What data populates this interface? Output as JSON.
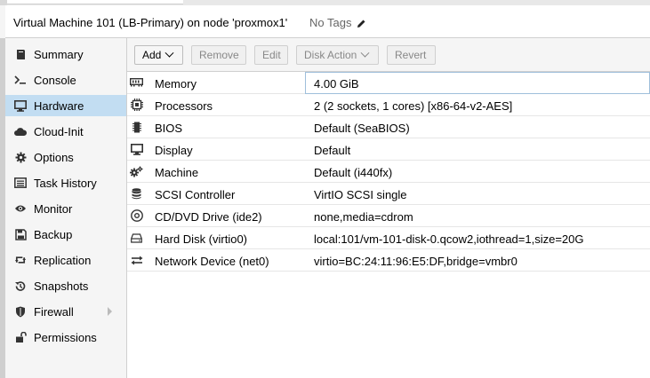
{
  "header": {
    "title": "Virtual Machine 101 (LB-Primary) on node 'proxmox1'",
    "tags_label": "No Tags"
  },
  "sidebar": {
    "items": [
      {
        "label": "Summary",
        "icon": "book-icon"
      },
      {
        "label": "Console",
        "icon": "terminal-icon"
      },
      {
        "label": "Hardware",
        "icon": "desktop-icon",
        "active": true
      },
      {
        "label": "Cloud-Init",
        "icon": "cloud-icon"
      },
      {
        "label": "Options",
        "icon": "gear-icon"
      },
      {
        "label": "Task History",
        "icon": "list-icon"
      },
      {
        "label": "Monitor",
        "icon": "eye-icon"
      },
      {
        "label": "Backup",
        "icon": "floppy-icon"
      },
      {
        "label": "Replication",
        "icon": "retweet-icon"
      },
      {
        "label": "Snapshots",
        "icon": "history-icon"
      },
      {
        "label": "Firewall",
        "icon": "shield-icon",
        "has_submenu": true
      },
      {
        "label": "Permissions",
        "icon": "unlock-icon"
      }
    ]
  },
  "toolbar": {
    "add_label": "Add",
    "remove_label": "Remove",
    "edit_label": "Edit",
    "disk_action_label": "Disk Action",
    "revert_label": "Revert"
  },
  "hardware": {
    "rows": [
      {
        "key": "Memory",
        "value": "4.00 GiB",
        "icon": "memory-icon",
        "selected": true
      },
      {
        "key": "Processors",
        "value": "2 (2 sockets, 1 cores) [x86-64-v2-AES]",
        "icon": "cpu-icon"
      },
      {
        "key": "BIOS",
        "value": "Default (SeaBIOS)",
        "icon": "microchip-icon"
      },
      {
        "key": "Display",
        "value": "Default",
        "icon": "desktop-icon"
      },
      {
        "key": "Machine",
        "value": "Default (i440fx)",
        "icon": "cogs-icon"
      },
      {
        "key": "SCSI Controller",
        "value": "VirtIO SCSI single",
        "icon": "database-icon"
      },
      {
        "key": "CD/DVD Drive (ide2)",
        "value": "none,media=cdrom",
        "icon": "cdrom-icon"
      },
      {
        "key": "Hard Disk (virtio0)",
        "value": "local:101/vm-101-disk-0.qcow2,iothread=1,size=20G",
        "icon": "hdd-icon"
      },
      {
        "key": "Network Device (net0)",
        "value": "virtio=BC:24:11:96:E5:DF,bridge=vmbr0",
        "icon": "exchange-icon"
      }
    ]
  },
  "colors": {
    "selected_nav": "#c2ddf2",
    "border": "#d0d0d0",
    "selected_row_border": "#9fbfdb"
  }
}
